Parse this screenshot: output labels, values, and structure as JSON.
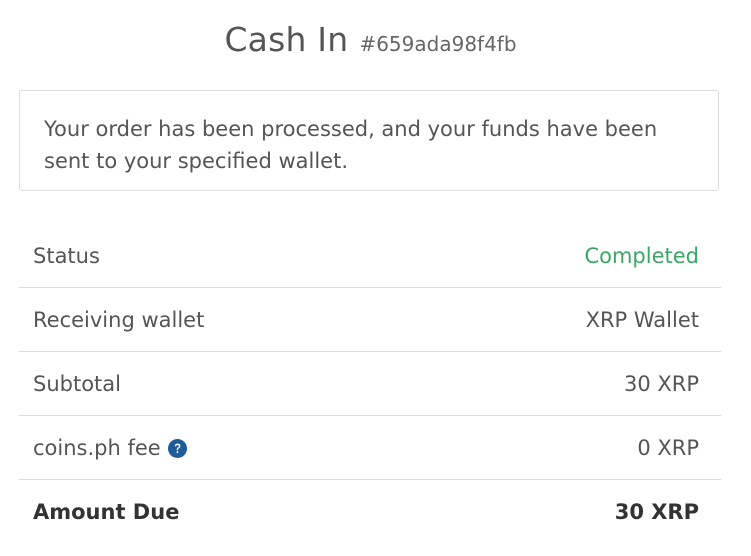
{
  "header": {
    "title": "Cash In",
    "order_id": "#659ada98f4fb"
  },
  "notice": {
    "message": "Your order has been processed, and your funds have been sent to your specified wallet."
  },
  "details": {
    "status": {
      "label": "Status",
      "value": "Completed"
    },
    "receiving_wallet": {
      "label": "Receiving wallet",
      "value": "XRP Wallet"
    },
    "subtotal": {
      "label": "Subtotal",
      "value": "30 XRP"
    },
    "fee": {
      "label": "coins.ph fee",
      "value": "0 XRP",
      "icon": "question-circle-icon"
    },
    "amount_due": {
      "label": "Amount Due",
      "value": "30 XRP"
    }
  },
  "colors": {
    "status_completed": "#3aa766",
    "help_icon": "#1f5c99"
  }
}
